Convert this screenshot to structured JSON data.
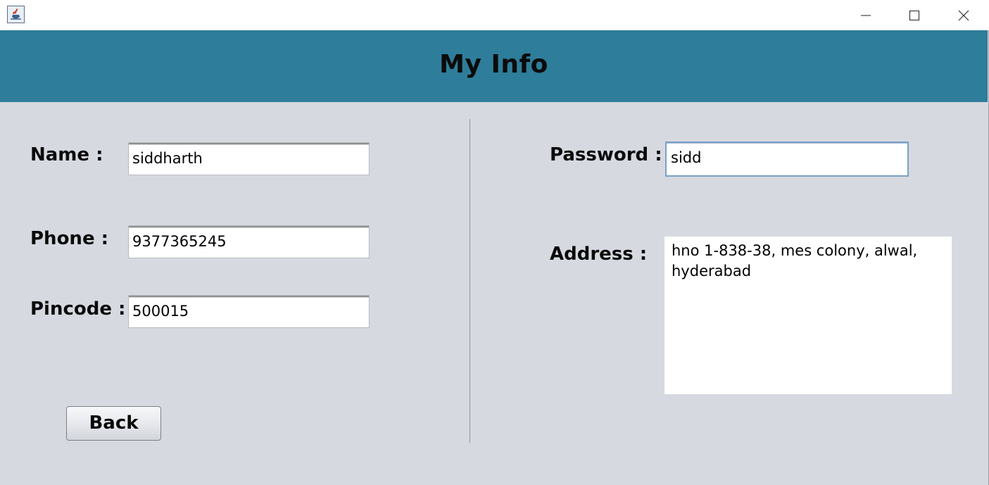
{
  "window": {
    "app_icon": "java-cup-icon",
    "controls": {
      "minimize": "minimize-icon",
      "maximize": "maximize-icon",
      "close": "close-icon"
    }
  },
  "header": {
    "title": "My Info",
    "background_color": "#2e7d9a"
  },
  "form": {
    "name": {
      "label": "Name :",
      "value": "siddharth"
    },
    "phone": {
      "label": "Phone :",
      "value": "9377365245"
    },
    "pincode": {
      "label": "Pincode :",
      "value": "500015"
    },
    "password": {
      "label": "Password :",
      "value": "sidd"
    },
    "address": {
      "label": "Address :",
      "value": "hno 1-838-38, mes colony, alwal, hyderabad"
    }
  },
  "actions": {
    "back_label": "Back"
  }
}
